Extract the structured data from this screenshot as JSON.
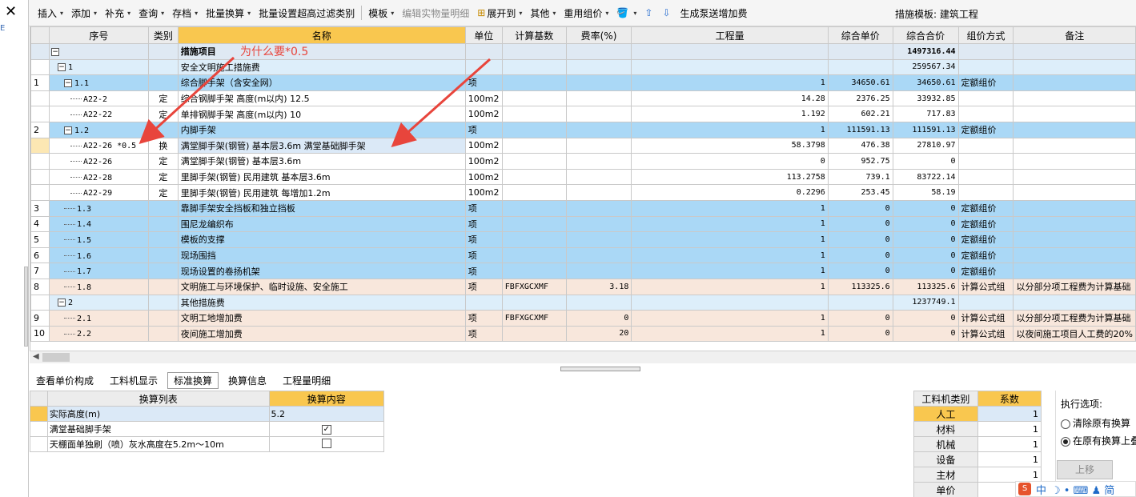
{
  "window": {
    "close_glyph": "✕",
    "left_mark": "E"
  },
  "toolbar": {
    "items": [
      {
        "label": "插入",
        "dd": true
      },
      {
        "label": "添加",
        "dd": true
      },
      {
        "label": "补充",
        "dd": true
      },
      {
        "label": "查询",
        "dd": true
      },
      {
        "label": "存档",
        "dd": true
      },
      {
        "label": "批量换算",
        "dd": true
      },
      {
        "label": "批量设置超高过滤类别",
        "dd": false
      },
      {
        "label": "模板",
        "dd": true
      },
      {
        "label": "编辑实物量明细",
        "dd": false,
        "disabled": true
      },
      {
        "label": "展开到",
        "dd": true,
        "icon": "expand-icon"
      },
      {
        "label": "其他",
        "dd": true
      },
      {
        "label": "重用组价",
        "dd": true
      },
      {
        "label": "",
        "dd": true,
        "icon": "paint-bucket-icon"
      },
      {
        "label": "",
        "dd": false,
        "icon": "arrow-up-icon"
      },
      {
        "label": "",
        "dd": false,
        "icon": "arrow-down-icon"
      },
      {
        "label": "生成泵送增加费",
        "dd": false
      }
    ],
    "template_label": "措施模板: 建筑工程"
  },
  "grid": {
    "headers": [
      "序号",
      "类别",
      "名称",
      "单位",
      "计算基数",
      "费率(%)",
      "工程量",
      "综合单价",
      "综合合价",
      "组价方式",
      "备注"
    ],
    "rows": [
      {
        "rn": "",
        "code": "",
        "ctl": "−",
        "lvl": 0,
        "cat": "",
        "name": "措施项目",
        "unit": "",
        "base": "",
        "rate": "",
        "qty": "",
        "price": "",
        "total": "1497316.44",
        "method": "",
        "note": "",
        "style": "top",
        "bold": true
      },
      {
        "rn": "",
        "code": "1",
        "ctl": "−",
        "lvl": 1,
        "cat": "",
        "name": "安全文明施工措施费",
        "unit": "",
        "base": "",
        "rate": "",
        "qty": "",
        "price": "",
        "total": "259567.34",
        "method": "",
        "note": "",
        "style": "lt"
      },
      {
        "rn": "1",
        "code": "1.1",
        "ctl": "−",
        "lvl": 2,
        "cat": "",
        "name": "综合脚手架（含安全网）",
        "unit": "项",
        "base": "",
        "rate": "",
        "qty": "1",
        "price": "34650.61",
        "total": "34650.61",
        "method": "定额组价",
        "note": "",
        "style": "blue"
      },
      {
        "rn": "",
        "code": "A22-2",
        "ctl": "",
        "lvl": 3,
        "cat": "定",
        "name": "综合钢脚手架 高度(m以内) 12.5",
        "unit": "100m2",
        "base": "",
        "rate": "",
        "qty": "14.28",
        "price": "2376.25",
        "total": "33932.85",
        "method": "",
        "note": "",
        "style": ""
      },
      {
        "rn": "",
        "code": "A22-22",
        "ctl": "",
        "lvl": 3,
        "cat": "定",
        "name": "单排钢脚手架 高度(m以内) 10",
        "unit": "100m2",
        "base": "",
        "rate": "",
        "qty": "1.192",
        "price": "602.21",
        "total": "717.83",
        "method": "",
        "note": "",
        "style": ""
      },
      {
        "rn": "2",
        "code": "1.2",
        "ctl": "−",
        "lvl": 2,
        "cat": "",
        "name": "内脚手架",
        "unit": "项",
        "base": "",
        "rate": "",
        "qty": "1",
        "price": "111591.13",
        "total": "111591.13",
        "method": "定额组价",
        "note": "",
        "style": "blue"
      },
      {
        "rn": "",
        "code": "A22-26 *0.5",
        "ctl": "",
        "lvl": 3,
        "cat": "换",
        "name": "满堂脚手架(钢管) 基本层3.6m 满堂基础脚手架",
        "unit": "100m2",
        "base": "",
        "rate": "",
        "qty": "58.3798",
        "price": "476.38",
        "total": "27810.97",
        "method": "",
        "note": "",
        "style": "sel"
      },
      {
        "rn": "",
        "code": "A22-26",
        "ctl": "",
        "lvl": 3,
        "cat": "定",
        "name": "满堂脚手架(钢管) 基本层3.6m",
        "unit": "100m2",
        "base": "",
        "rate": "",
        "qty": "0",
        "price": "952.75",
        "total": "0",
        "method": "",
        "note": "",
        "style": ""
      },
      {
        "rn": "",
        "code": "A22-28",
        "ctl": "",
        "lvl": 3,
        "cat": "定",
        "name": "里脚手架(钢管) 民用建筑 基本层3.6m",
        "unit": "100m2",
        "base": "",
        "rate": "",
        "qty": "113.2758",
        "price": "739.1",
        "total": "83722.14",
        "method": "",
        "note": "",
        "style": ""
      },
      {
        "rn": "",
        "code": "A22-29",
        "ctl": "",
        "lvl": 3,
        "cat": "定",
        "name": "里脚手架(钢管) 民用建筑 每增加1.2m",
        "unit": "100m2",
        "base": "",
        "rate": "",
        "qty": "0.2296",
        "price": "253.45",
        "total": "58.19",
        "method": "",
        "note": "",
        "style": ""
      },
      {
        "rn": "3",
        "code": "1.3",
        "ctl": "",
        "lvl": 2,
        "cat": "",
        "name": "靠脚手架安全挡板和独立挡板",
        "unit": "项",
        "base": "",
        "rate": "",
        "qty": "1",
        "price": "0",
        "total": "0",
        "method": "定额组价",
        "note": "",
        "style": "blue"
      },
      {
        "rn": "4",
        "code": "1.4",
        "ctl": "",
        "lvl": 2,
        "cat": "",
        "name": "围尼龙编织布",
        "unit": "项",
        "base": "",
        "rate": "",
        "qty": "1",
        "price": "0",
        "total": "0",
        "method": "定额组价",
        "note": "",
        "style": "blue"
      },
      {
        "rn": "5",
        "code": "1.5",
        "ctl": "",
        "lvl": 2,
        "cat": "",
        "name": "模板的支撑",
        "unit": "项",
        "base": "",
        "rate": "",
        "qty": "1",
        "price": "0",
        "total": "0",
        "method": "定额组价",
        "note": "",
        "style": "blue"
      },
      {
        "rn": "6",
        "code": "1.6",
        "ctl": "",
        "lvl": 2,
        "cat": "",
        "name": "现场围挡",
        "unit": "项",
        "base": "",
        "rate": "",
        "qty": "1",
        "price": "0",
        "total": "0",
        "method": "定额组价",
        "note": "",
        "style": "blue"
      },
      {
        "rn": "7",
        "code": "1.7",
        "ctl": "",
        "lvl": 2,
        "cat": "",
        "name": "现场设置的卷扬机架",
        "unit": "项",
        "base": "",
        "rate": "",
        "qty": "1",
        "price": "0",
        "total": "0",
        "method": "定额组价",
        "note": "",
        "style": "blue"
      },
      {
        "rn": "8",
        "code": "1.8",
        "ctl": "",
        "lvl": 2,
        "cat": "",
        "name": "文明施工与环境保护、临时设施、安全施工",
        "unit": "项",
        "base": "FBFXGCXMF",
        "rate": "3.18",
        "qty": "1",
        "price": "113325.6",
        "total": "113325.6",
        "method": "计算公式组",
        "note": "以分部分项工程费为计算基础",
        "style": "tan"
      },
      {
        "rn": "",
        "code": "2",
        "ctl": "−",
        "lvl": 1,
        "cat": "",
        "name": "其他措施费",
        "unit": "",
        "base": "",
        "rate": "",
        "qty": "",
        "price": "",
        "total": "1237749.1",
        "method": "",
        "note": "",
        "style": "lt"
      },
      {
        "rn": "9",
        "code": "2.1",
        "ctl": "",
        "lvl": 2,
        "cat": "",
        "name": "文明工地增加费",
        "unit": "项",
        "base": "FBFXGCXMF",
        "rate": "0",
        "qty": "1",
        "price": "0",
        "total": "0",
        "method": "计算公式组",
        "note": "以分部分项工程费为计算基础",
        "style": "tan"
      },
      {
        "rn": "10",
        "code": "2.2",
        "ctl": "",
        "lvl": 2,
        "cat": "",
        "name": "夜间施工增加费",
        "unit": "项",
        "base": "",
        "rate": "20",
        "qty": "1",
        "price": "0",
        "total": "0",
        "method": "计算公式组",
        "note": "以夜间施工项目人工费的20%",
        "style": "tan"
      }
    ]
  },
  "annotation": {
    "text": "为什么要*0.5",
    "color": "#e8453c"
  },
  "bottom_tabs": [
    "查看单价构成",
    "工料机显示",
    "标准换算",
    "换算信息",
    "工程量明细"
  ],
  "active_tab": "标准换算",
  "calc_table": {
    "headers": [
      "换算列表",
      "换算内容"
    ],
    "rows": [
      {
        "label": "实际高度(m)",
        "value": "5.2",
        "type": "text"
      },
      {
        "label": "满堂基础脚手架",
        "value": "",
        "type": "check",
        "checked": true
      },
      {
        "label": "天棚面单独刷（喷）灰水高度在5.2m～10m",
        "value": "",
        "type": "check",
        "checked": false
      }
    ]
  },
  "coef_table": {
    "headers": [
      "工料机类别",
      "系数"
    ],
    "rows": [
      {
        "label": "人工",
        "value": "1"
      },
      {
        "label": "材料",
        "value": "1"
      },
      {
        "label": "机械",
        "value": "1"
      },
      {
        "label": "设备",
        "value": "1"
      },
      {
        "label": "主材",
        "value": "1"
      },
      {
        "label": "单价",
        "value": ""
      }
    ]
  },
  "options": {
    "title": "执行选项:",
    "radio1": "清除原有换算",
    "radio2": "在原有换算上叠",
    "up_button": "上移"
  },
  "ime": {
    "logo": "S",
    "lang": "中",
    "icons": "☽ • ⌨ ♟ 简"
  },
  "colors": {
    "row_blue": "#aad8f6",
    "row_tan": "#f8e7dc",
    "header_orange": "#f9c74f",
    "annotation_red": "#e8453c"
  }
}
